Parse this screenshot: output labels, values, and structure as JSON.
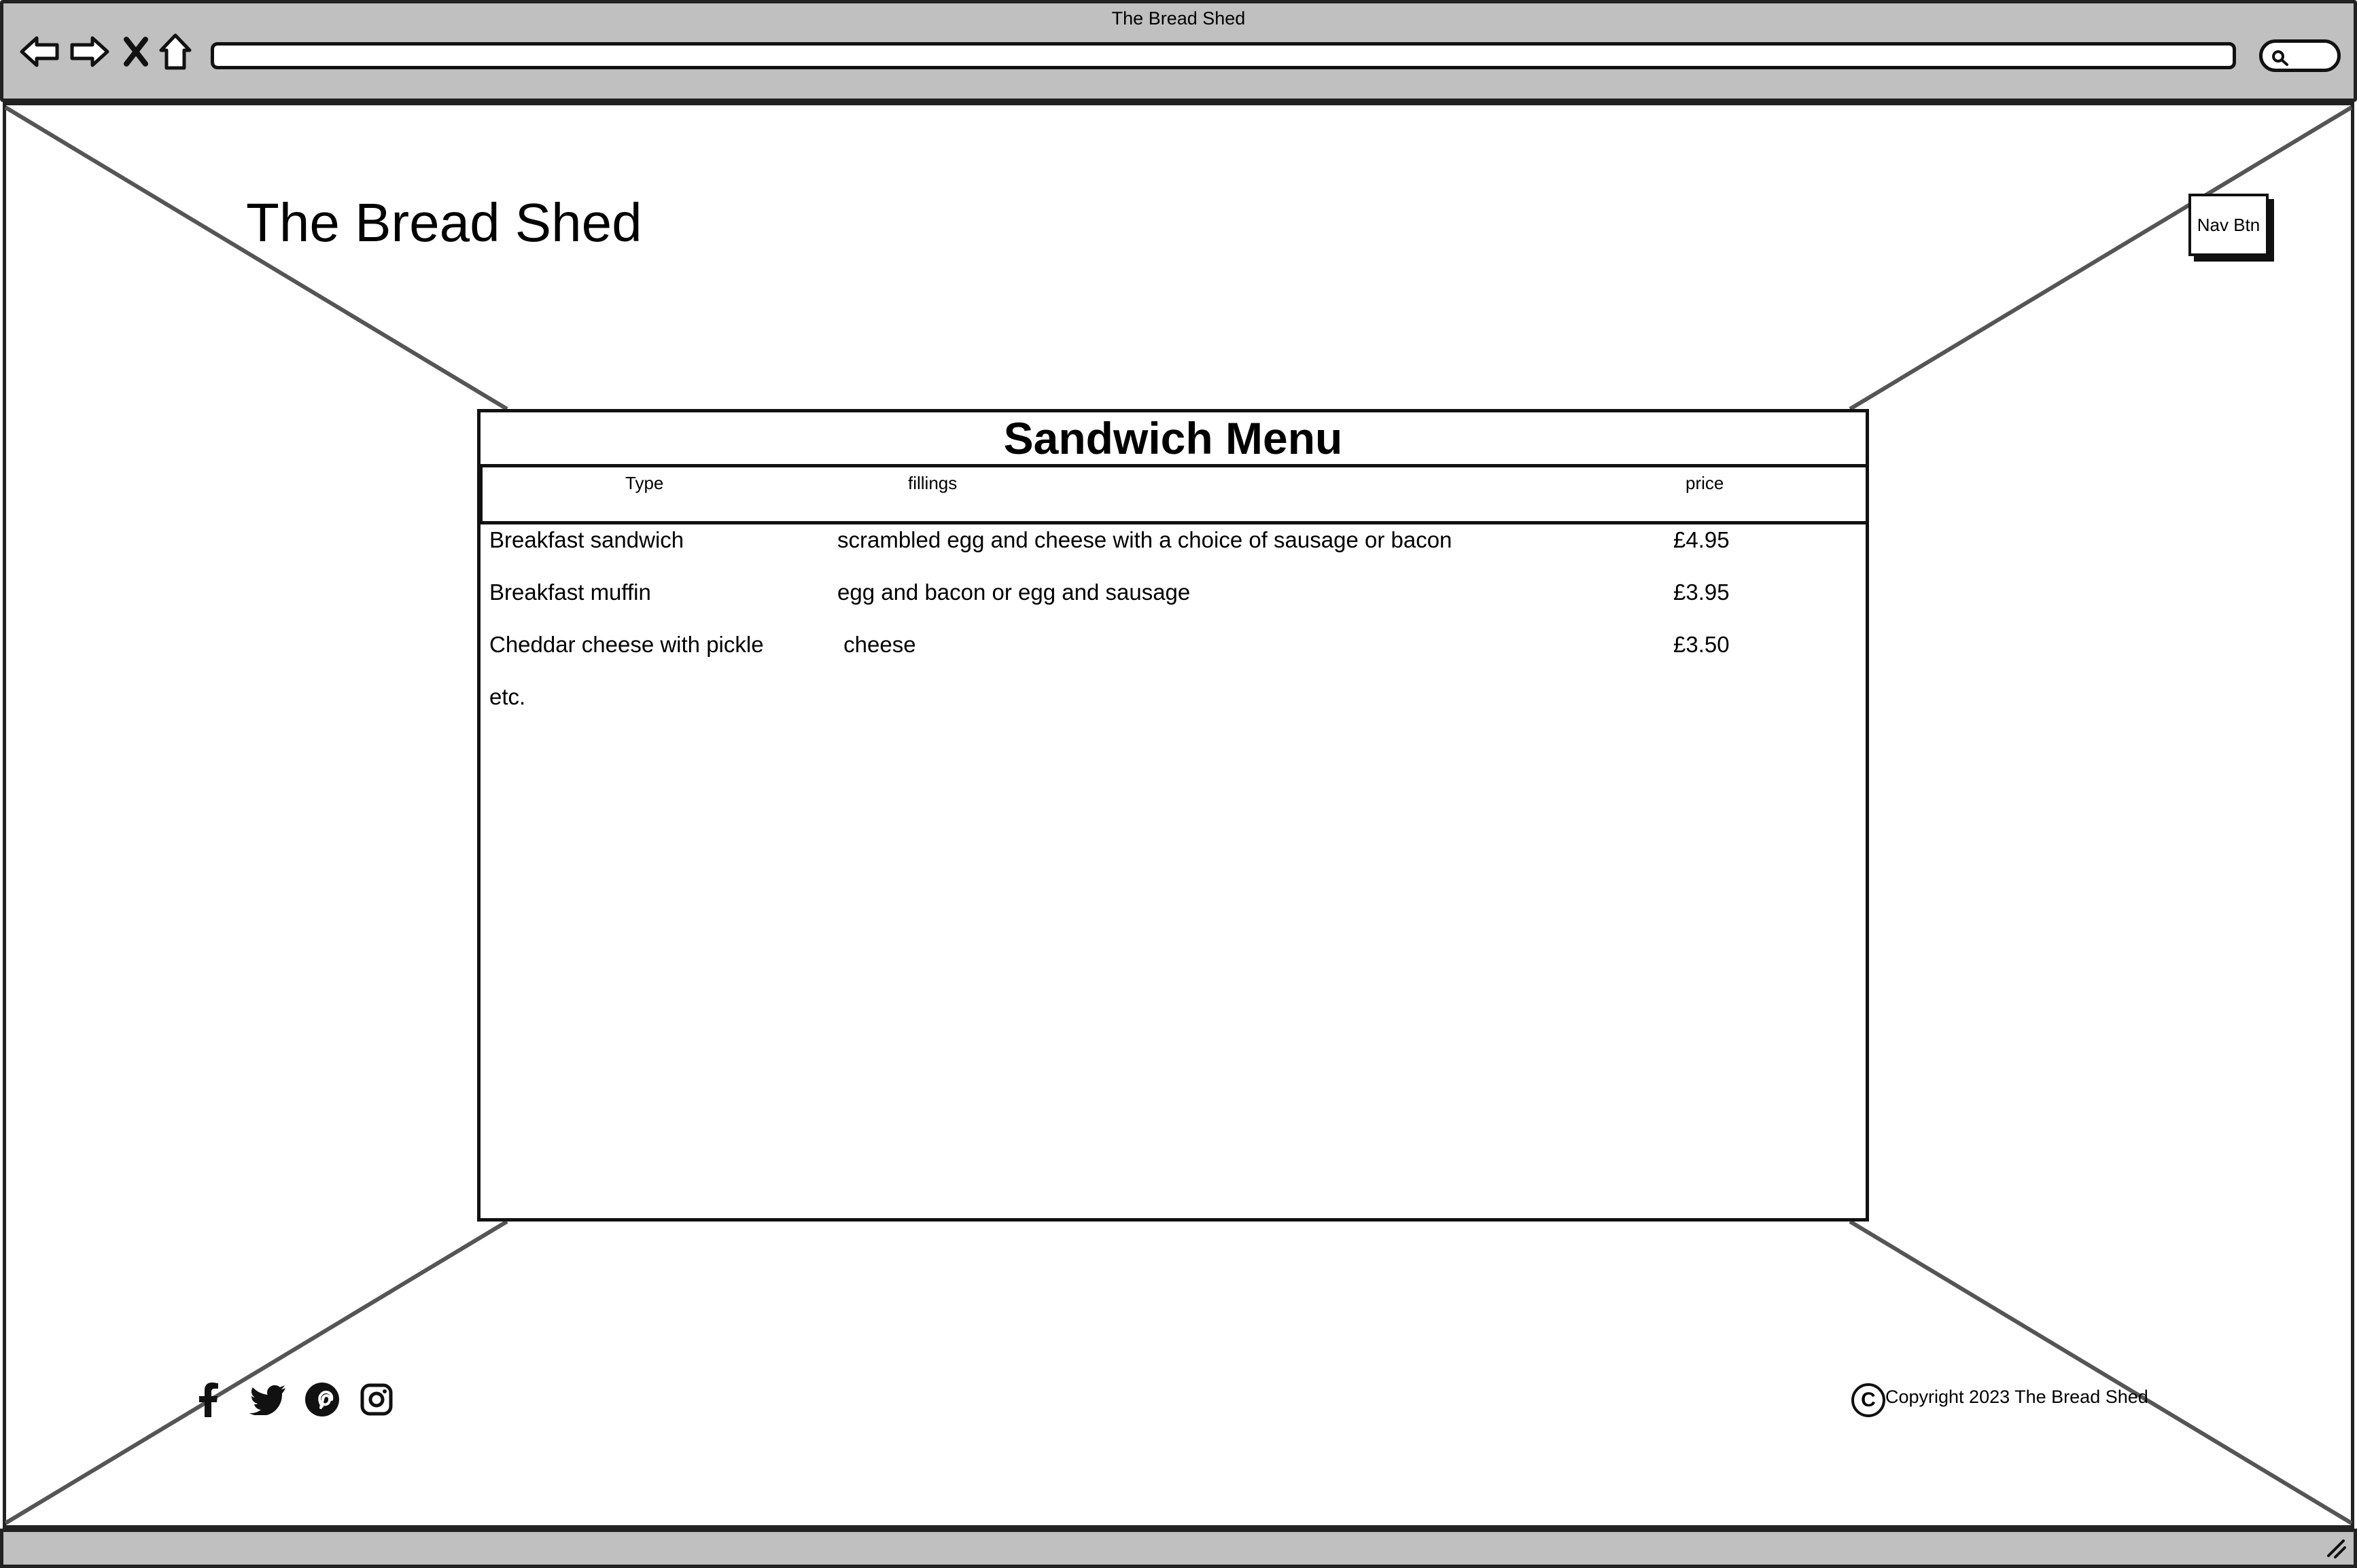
{
  "browser": {
    "window_title": "The Bread Shed",
    "icons": [
      "back-arrow-icon",
      "forward-arrow-icon",
      "close-x-icon",
      "home-icon",
      "search-icon",
      "resize-grip-icon"
    ]
  },
  "header": {
    "logo": "The Bread Shed",
    "nav_button": "Nav Btn"
  },
  "menu": {
    "title": "Sandwich Menu",
    "columns": [
      "Type",
      "fillings",
      "price"
    ],
    "rows": [
      {
        "type": "Breakfast sandwich",
        "fillings": "scrambled egg and cheese with a choice of sausage or bacon",
        "price": "£4.95"
      },
      {
        "type": "Breakfast muffin",
        "fillings": "egg and bacon or egg and sausage",
        "price": "£3.95"
      },
      {
        "type": "Cheddar cheese with pickle",
        "fillings": " cheese",
        "price": "£3.50"
      },
      {
        "type": "etc.",
        "fillings": "",
        "price": ""
      }
    ]
  },
  "footer": {
    "social_icons": [
      "facebook-icon",
      "twitter-icon",
      "pinterest-icon",
      "instagram-icon"
    ],
    "copyright_symbol": "C",
    "copyright": "Copyright 2023 The Bread Shed"
  }
}
